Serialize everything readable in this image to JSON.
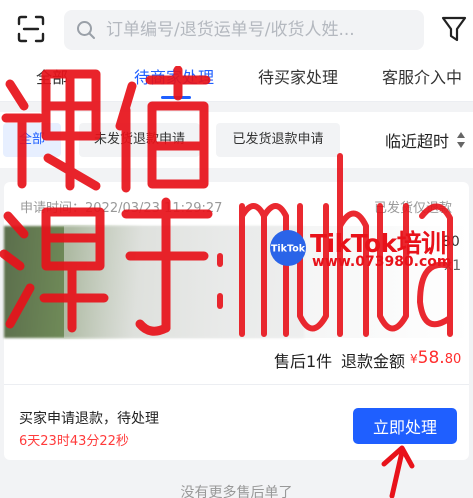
{
  "search": {
    "placeholder": "订单编号/退货运单号/收货人姓..."
  },
  "tabs": [
    {
      "label": "全部"
    },
    {
      "label": "待商家处理"
    },
    {
      "label": "待买家处理"
    },
    {
      "label": "客服介入中"
    }
  ],
  "chips": [
    {
      "label": "全部"
    },
    {
      "label": "未发货退款申请"
    },
    {
      "label": "已发货退款申请"
    }
  ],
  "sort": {
    "label": "临近超时"
  },
  "order": {
    "apply_time": "申请时间：2022/03/23 11:29:27",
    "status": "已发货仅退款",
    "product": {
      "price": "80",
      "quantity": "x1"
    },
    "summary": {
      "count_text": "售后1件",
      "amount_label": "退款金额",
      "currency": "¥",
      "amount_int": "58.",
      "amount_dec": "80"
    },
    "pending_text": "买家申请退款，待处理",
    "countdown": "6天23时43分22秒",
    "action_label": "立即处理"
  },
  "footer": {
    "no_more_text": "没有更多售后单了"
  },
  "watermark": {
    "brand": "TikTok培训",
    "url": "www.073980.com",
    "badge": "TikTok"
  },
  "colors": {
    "accent": "#1f5fff",
    "price": "#ff2e2e",
    "countdown": "#ff3b3b",
    "watermark": "#e8121a",
    "background": "#f2f3f5"
  },
  "icons": {
    "scan": "scan-icon",
    "search": "search-icon",
    "filter": "filter-icon",
    "sort": "sort-arrows-icon"
  }
}
